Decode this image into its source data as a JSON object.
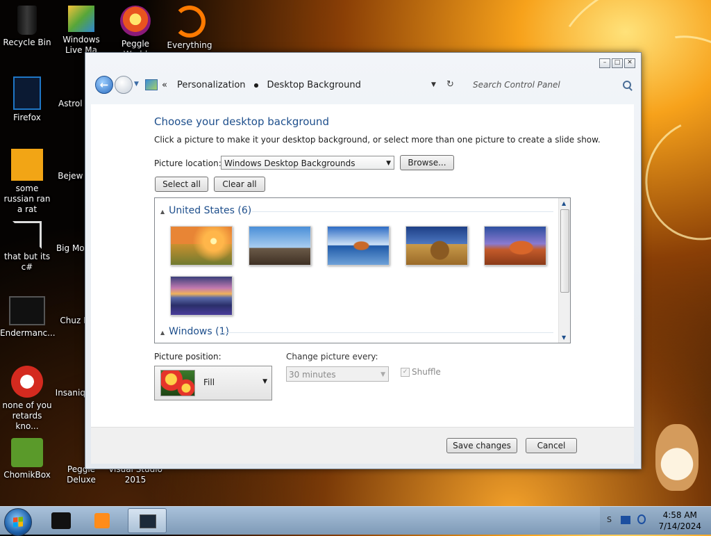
{
  "desktop": {
    "icons": [
      {
        "label": "Recycle Bin",
        "icon": "recycle-bin-icon"
      },
      {
        "label": "Firefox",
        "icon": "firefox-icon"
      },
      {
        "label": "some russian ran a rat",
        "icon": "program-icon"
      },
      {
        "label": "that but its c#",
        "icon": "shortcut-icon"
      },
      {
        "label": "Endermanc...",
        "icon": "program-icon"
      },
      {
        "label": "none of you retards kno...",
        "icon": "program-icon"
      },
      {
        "label": "ChomikBox",
        "icon": "chomikbox-icon"
      },
      {
        "label": "Windows Live Ma",
        "icon": "windows-live-icon"
      },
      {
        "label": "Astrol Delu",
        "icon": "game-icon"
      },
      {
        "label": "Bejew Delu",
        "icon": "game-icon"
      },
      {
        "label": "Big Mo Delu",
        "icon": "game-icon"
      },
      {
        "label": "Chuz Delu",
        "icon": "game-icon"
      },
      {
        "label": "Insaniq Delu",
        "icon": "game-icon"
      },
      {
        "label": "Peggle Deluxe",
        "icon": "peggle-icon"
      },
      {
        "label": "Peggle World",
        "icon": "peggle-icon"
      },
      {
        "label": "Visual Studio 2015",
        "icon": "visual-studio-icon"
      },
      {
        "label": "Everything",
        "icon": "search-app-icon"
      }
    ]
  },
  "window": {
    "address": {
      "overflow": "«",
      "crumb1": "Personalization",
      "crumb2": "Desktop Background"
    },
    "search_placeholder": "Search Control Panel",
    "title": "Choose your desktop background",
    "description": "Click a picture to make it your desktop background, or select more than one picture to create a slide show.",
    "picture_location_label": "Picture location:",
    "picture_location_value": "Windows Desktop Backgrounds",
    "browse_label": "Browse...",
    "select_all_label": "Select all",
    "clear_all_label": "Clear all",
    "groups": [
      {
        "name": "United States (6)",
        "pictures": [
          "sunset-meadow",
          "lighthouse",
          "rock-lake",
          "hay-bale",
          "delicate-arch",
          "lupine-lake"
        ]
      },
      {
        "name": "Windows (1)",
        "pictures": []
      }
    ],
    "picture_position_label": "Picture position:",
    "picture_position_value": "Fill",
    "change_every_label": "Change picture every:",
    "change_every_value": "30 minutes",
    "shuffle_label": "Shuffle",
    "save_label": "Save changes",
    "cancel_label": "Cancel"
  },
  "taskbar": {
    "time": "4:58 AM",
    "date": "7/14/2024",
    "tray_text": "S"
  },
  "colors": {
    "heading": "#1e4f8c",
    "taskbar": "#a9c2db"
  }
}
